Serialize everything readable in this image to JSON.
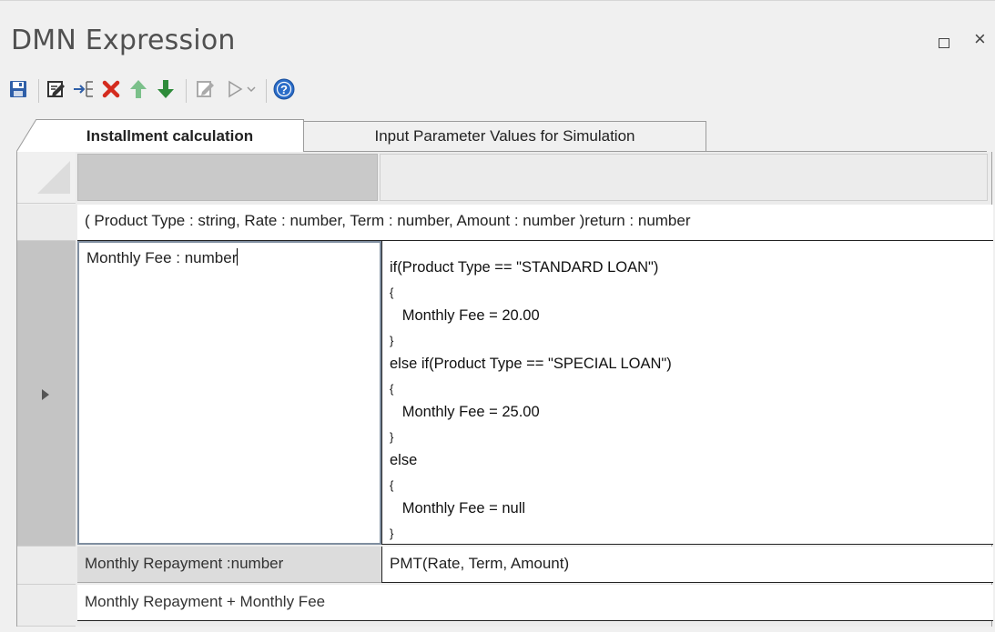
{
  "window": {
    "title": "DMN Expression",
    "maximize_icon": "maximize-icon",
    "close_glyph": "×"
  },
  "toolbar": {
    "buttons": [
      {
        "icon": "save-icon"
      },
      {
        "icon": "edit-icon"
      },
      {
        "icon": "insert-row-icon"
      },
      {
        "icon": "delete-icon",
        "color": "#d42b1e"
      },
      {
        "icon": "arrow-up-icon",
        "color": "#7bc08a"
      },
      {
        "icon": "arrow-down-icon",
        "color": "#2e8b3a"
      },
      {
        "icon": "validate-icon"
      },
      {
        "icon": "run-icon"
      },
      {
        "icon": "help-icon",
        "color": "#2a6cc8"
      }
    ]
  },
  "tabs": [
    {
      "label": "Installment calculation",
      "active": true
    },
    {
      "label": "Input Parameter Values for Simulation",
      "active": false
    }
  ],
  "grid": {
    "signature": "( Product Type : string, Rate : number, Term : number, Amount : number )return : number",
    "rows": [
      {
        "name": "Monthly Fee : number",
        "expression_lines": [
          "if(Product Type == \"STANDARD LOAN\")",
          "{",
          "   Monthly Fee = 20.00",
          "}",
          "else if(Product Type == \"SPECIAL LOAN\")",
          "{",
          "   Monthly Fee = 25.00",
          "}",
          "else",
          "{",
          "   Monthly Fee = null",
          "}"
        ]
      },
      {
        "name": "Monthly Repayment :number",
        "expression": "PMT(Rate, Term, Amount)"
      }
    ],
    "result": "Monthly Repayment + Monthly Fee"
  }
}
